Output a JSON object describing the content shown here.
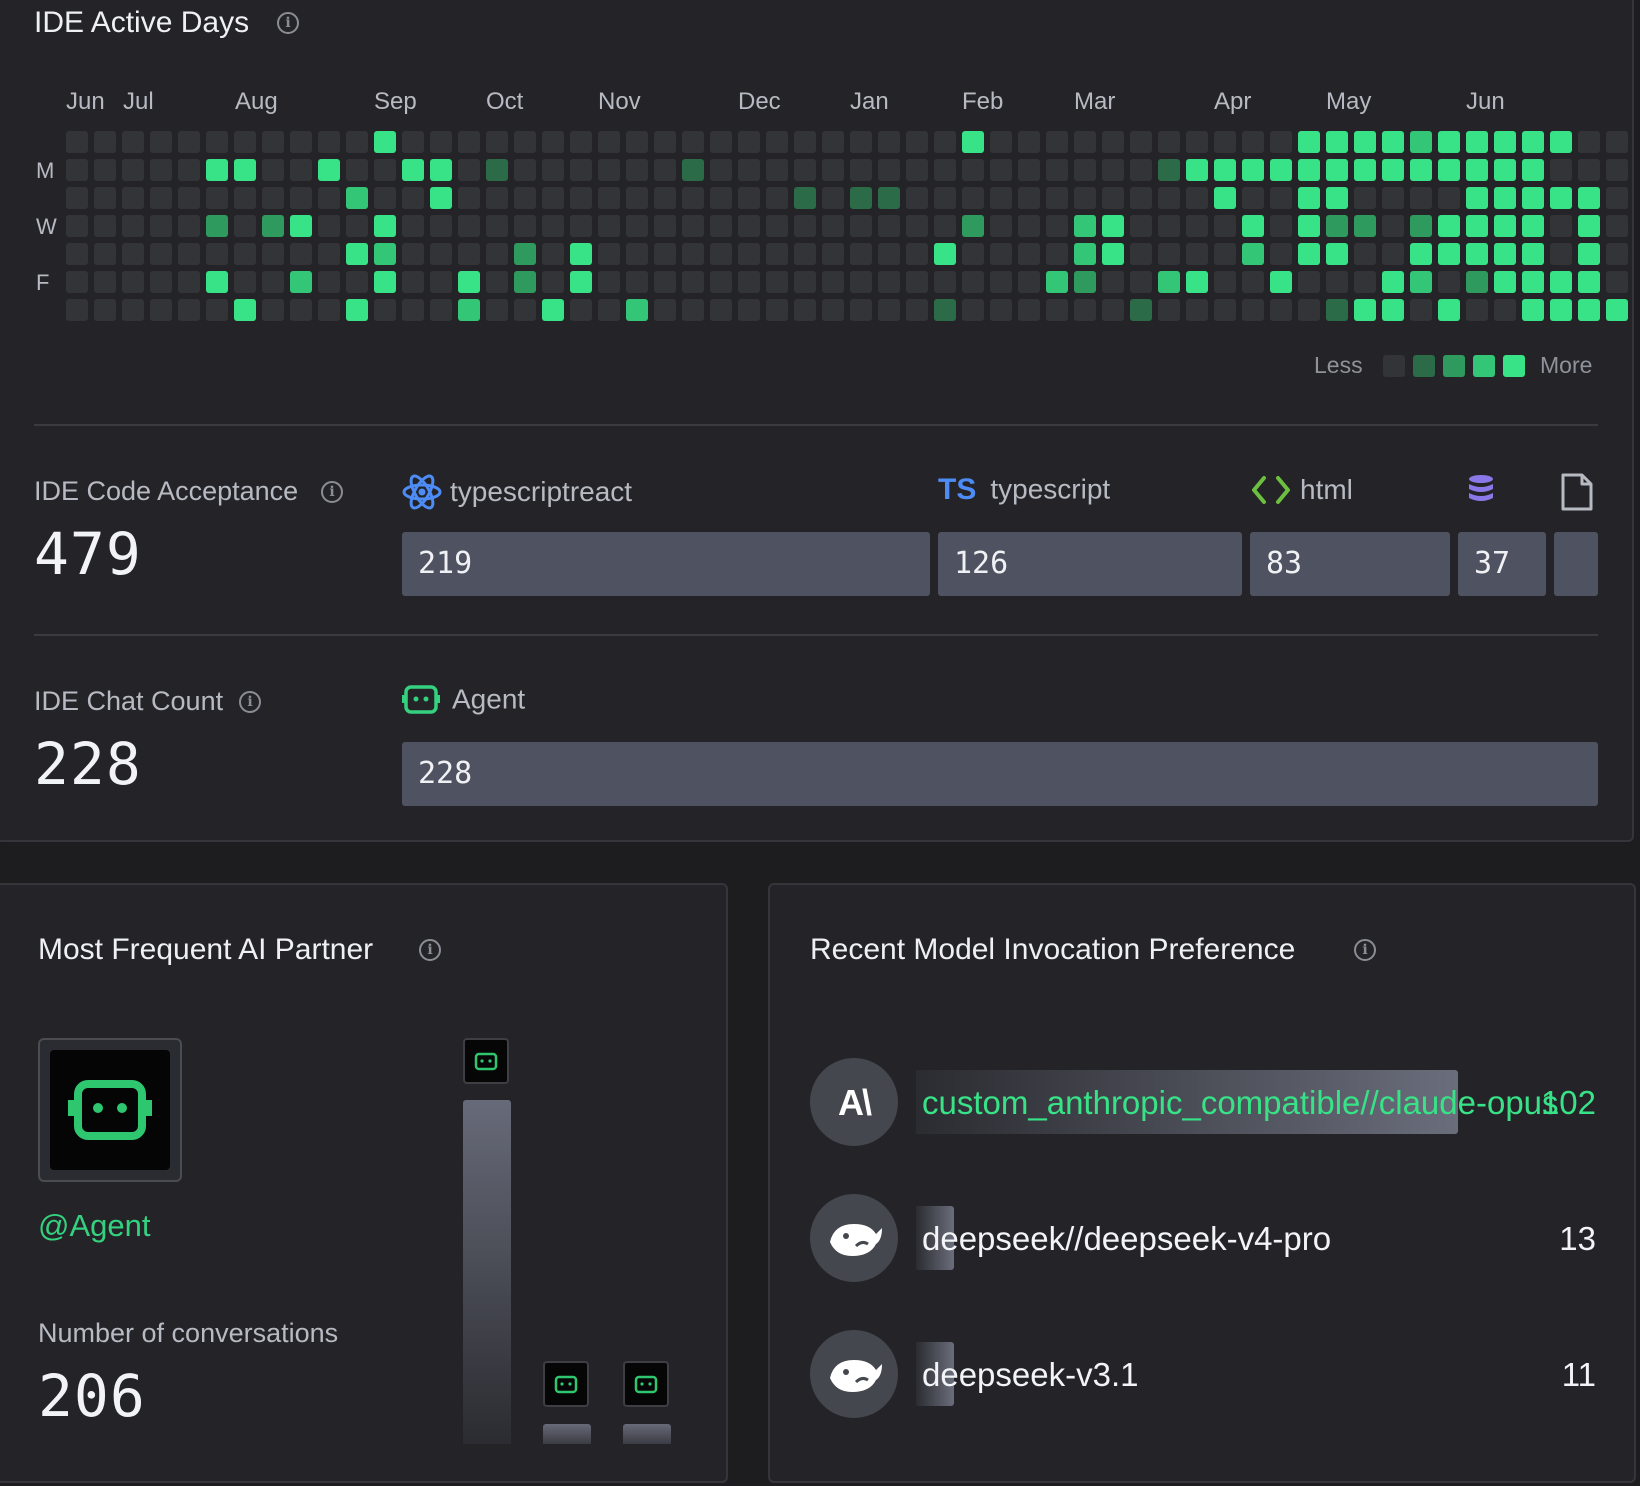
{
  "active_days": {
    "title": "IDE Active Days",
    "months": [
      "Jun",
      "Jul",
      "Aug",
      "Sep",
      "Oct",
      "Nov",
      "Dec",
      "Jan",
      "Feb",
      "Mar",
      "Apr",
      "May",
      "Jun"
    ],
    "day_labels": [
      "M",
      "W",
      "F"
    ],
    "legend_less": "Less",
    "legend_more": "More",
    "level_colors": [
      "#333438",
      "#2b6b47",
      "#2f9a5e",
      "#34c677",
      "#38e387"
    ],
    "activity_grid": [
      "00000000000400000000000000000000400000000000444434444400",
      "00000440040044010000001000000000000000014444444444444000",
      "00000000003004000000000000101100000000000400440000444440",
      "00000202400400000000000000000000200034000040422024444040",
      "00000000004300002040000000000004000034000030440044444040",
      "00000400300400402040000000000000000320034004000430244440",
      "00000040004000300400300000000001000000100000014404004444"
    ]
  },
  "code_acceptance": {
    "label": "IDE Code Acceptance",
    "total": "479",
    "languages": [
      {
        "name": "typescriptreact",
        "icon": "react-icon",
        "value": "219",
        "count": 219
      },
      {
        "name": "typescript",
        "icon": "typescript-icon",
        "icon_text": "TS",
        "value": "126",
        "count": 126
      },
      {
        "name": "html",
        "icon": "code-brackets-icon",
        "value": "83",
        "count": 83
      },
      {
        "name": "",
        "icon": "database-icon",
        "value": "37",
        "count": 37
      },
      {
        "name": "",
        "icon": "file-icon",
        "value": "",
        "count": 14
      }
    ]
  },
  "chat_count": {
    "label": "IDE Chat Count",
    "total": "228",
    "modes": [
      {
        "name": "Agent",
        "icon": "agent-icon",
        "value": "228",
        "count": 228
      }
    ]
  },
  "ai_partner": {
    "title": "Most Frequent AI Partner",
    "name": "@Agent",
    "conversations_label": "Number of conversations",
    "conversations": "206",
    "ranking": [
      {
        "icon": "agent-icon",
        "count": 206
      },
      {
        "icon": "agent-icon",
        "count": 11
      },
      {
        "icon": "agent-icon",
        "count": 11
      }
    ]
  },
  "model_preference": {
    "title": "Recent Model Invocation Preference",
    "models": [
      {
        "name": "custom_anthropic_compatible//claude-opus",
        "count": "102",
        "value": 102,
        "logo": "anthropic-logo",
        "logo_text": "A\\",
        "highlight": "#38e387"
      },
      {
        "name": "deepseek//deepseek-v4-pro",
        "count": "13",
        "value": 13,
        "logo": "deepseek-whale-logo"
      },
      {
        "name": "deepseek-v3.1",
        "count": "11",
        "value": 11,
        "logo": "deepseek-whale-logo"
      }
    ]
  }
}
